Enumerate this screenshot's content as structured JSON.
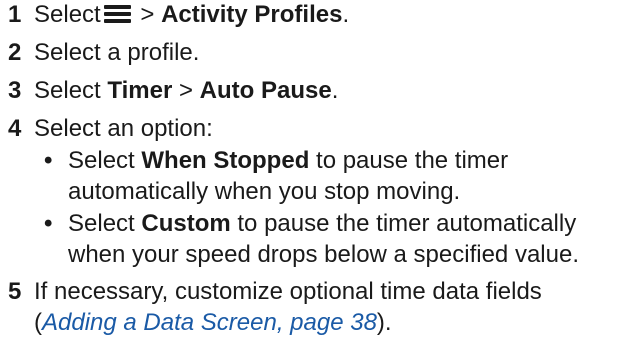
{
  "steps": [
    {
      "num": "1",
      "pre": "Select",
      "icon": "menu-icon",
      "mid": " > ",
      "bold1": "Activity Profiles",
      "post": "."
    },
    {
      "num": "2",
      "text": "Select a profile."
    },
    {
      "num": "3",
      "pre": "Select ",
      "bold1": "Timer",
      "mid": " > ",
      "bold2": "Auto Pause",
      "post": "."
    },
    {
      "num": "4",
      "text": "Select an option:",
      "options": [
        {
          "bullet": "•",
          "pre": "Select ",
          "bold": "When Stopped",
          "line1_post": " to pause the timer",
          "line2": "automatically when you stop moving."
        },
        {
          "bullet": "•",
          "pre": "Select ",
          "bold": "Custom",
          "line1_post": " to pause the timer automatically",
          "line2": "when your speed drops below a specified value."
        }
      ]
    },
    {
      "num": "5",
      "line1": "If necessary, customize optional time data fields",
      "line2_pre": "(",
      "line2_link": "Adding a Data Screen, page 38",
      "line2_post": ")."
    }
  ]
}
